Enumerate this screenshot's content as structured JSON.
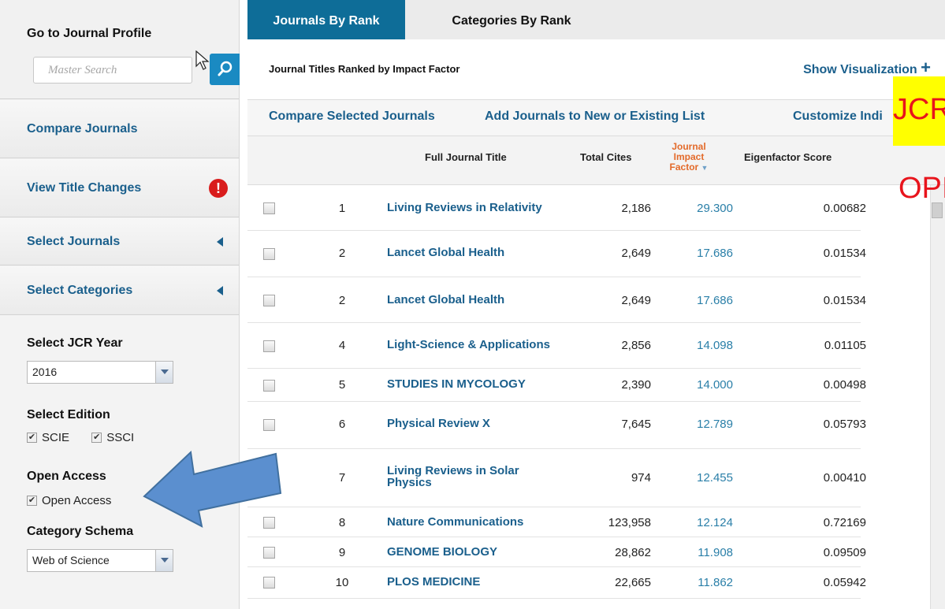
{
  "sidebar": {
    "profile_title": "Go to Journal Profile",
    "search_placeholder": "Master Search",
    "compare": "Compare Journals",
    "title_changes": "View Title Changes",
    "alert_glyph": "!",
    "select_journals": "Select Journals",
    "select_categories": "Select Categories",
    "year_label": "Select JCR Year",
    "year_value": "2016",
    "edition_label": "Select Edition",
    "editions": [
      "SCIE",
      "SSCI"
    ],
    "oa_label": "Open Access",
    "oa_option": "Open Access",
    "schema_label": "Category Schema",
    "schema_value": "Web of Science",
    "check_glyph": "✔"
  },
  "tabs": {
    "active": "Journals By Rank",
    "other": "Categories By Rank"
  },
  "header": {
    "title": "Journal Titles Ranked by Impact Factor",
    "visualization": "Show Visualization",
    "plus_glyph": "+"
  },
  "actions": {
    "compare": "Compare Selected Journals",
    "add": "Add Journals to New or Existing List",
    "customize": "Customize Indi"
  },
  "columns": {
    "title": "Full Journal Title",
    "cites": "Total Cites",
    "jif_line1": "Journal",
    "jif_line2": "Impact",
    "jif_line3": "Factor",
    "sort_glyph": "▼",
    "eigen": "Eigenfactor Score"
  },
  "rows": [
    {
      "rank": "1",
      "title": "Living Reviews in Relativity",
      "cites": "2,186",
      "jif": "29.300",
      "eigen": "0.00682"
    },
    {
      "rank": "2",
      "title": "Lancet Global Health",
      "cites": "2,649",
      "jif": "17.686",
      "eigen": "0.01534"
    },
    {
      "rank": "2",
      "title": "Lancet Global Health",
      "cites": "2,649",
      "jif": "17.686",
      "eigen": "0.01534"
    },
    {
      "rank": "4",
      "title": "Light-Science & Applications",
      "cites": "2,856",
      "jif": "14.098",
      "eigen": "0.01105"
    },
    {
      "rank": "5",
      "title": "STUDIES IN MYCOLOGY",
      "cites": "2,390",
      "jif": "14.000",
      "eigen": "0.00498"
    },
    {
      "rank": "6",
      "title": "Physical Review X",
      "cites": "7,645",
      "jif": "12.789",
      "eigen": "0.05793"
    },
    {
      "rank": "7",
      "title": "Living Reviews in Solar Physics",
      "cites": "974",
      "jif": "12.455",
      "eigen": "0.00410"
    },
    {
      "rank": "8",
      "title": "Nature Communications",
      "cites": "123,958",
      "jif": "12.124",
      "eigen": "0.72169"
    },
    {
      "rank": "9",
      "title": "GENOME BIOLOGY",
      "cites": "28,862",
      "jif": "11.908",
      "eigen": "0.09509"
    },
    {
      "rank": "10",
      "title": "PLOS MEDICINE",
      "cites": "22,665",
      "jif": "11.862",
      "eigen": "0.05942"
    }
  ],
  "overlay": {
    "text1": "JCR",
    "text2": "OPI"
  },
  "colors": {
    "accent": "#0e6d98",
    "link": "#1a5f8c",
    "jif_header": "#e36a2a",
    "alert": "#d91c1c",
    "arrow": "#5b8fcf",
    "overlay_text": "#e8141c",
    "overlay_bg": "#ffff00"
  }
}
